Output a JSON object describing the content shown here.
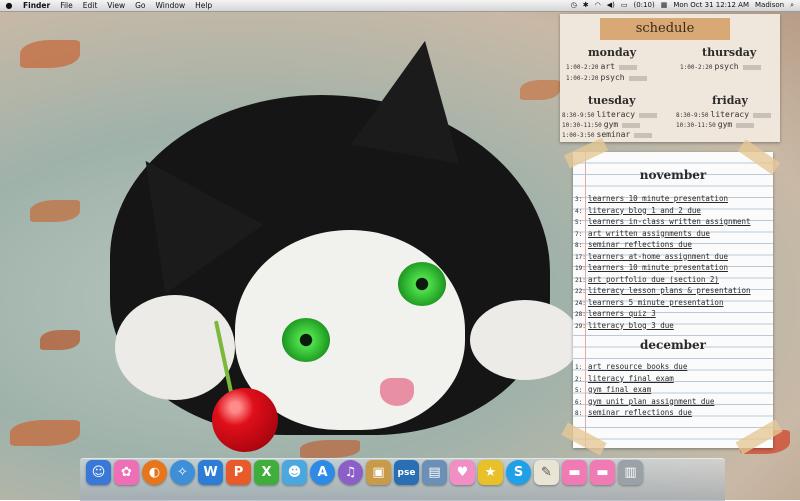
{
  "menubar": {
    "apple": "",
    "items": [
      "Finder",
      "File",
      "Edit",
      "View",
      "Go",
      "Window",
      "Help"
    ],
    "battery": "(0:10)",
    "datetime": "Mon Oct 31  12:12 AM",
    "user": "Madison"
  },
  "schedule": {
    "title": "schedule",
    "monday": {
      "label": "monday",
      "rows": [
        {
          "time": "1:00-2:20",
          "subject": "art"
        },
        {
          "time": "1:00-2:20",
          "subject": "psych"
        }
      ]
    },
    "thursday": {
      "label": "thursday",
      "rows": [
        {
          "time": "1:00-2:20",
          "subject": "psych"
        }
      ]
    },
    "tuesday": {
      "label": "tuesday",
      "rows": [
        {
          "time": "8:30-9:50",
          "subject": "literacy"
        },
        {
          "time": "10:30-11:50",
          "subject": "gym"
        },
        {
          "time": "1:00-3:50",
          "subject": "seminar"
        }
      ]
    },
    "friday": {
      "label": "friday",
      "rows": [
        {
          "time": "8:30-9:50",
          "subject": "literacy"
        },
        {
          "time": "10:30-11:50",
          "subject": "gym"
        }
      ]
    }
  },
  "paper": {
    "november": "november",
    "december": "december",
    "nov_items": [
      {
        "d": "3:",
        "t": "learners 10 minute presentation"
      },
      {
        "d": "4:",
        "t": "literacy blog 1 and 2 due"
      },
      {
        "d": "5:",
        "t": "learners in-class written assignment"
      },
      {
        "d": "7:",
        "t": "art written assignments due"
      },
      {
        "d": "8:",
        "t": "seminar            reflections due"
      },
      {
        "d": "17:",
        "t": "learners at-home assignment due"
      },
      {
        "d": "19:",
        "t": "learners 10 minute presentation"
      },
      {
        "d": "21:",
        "t": "art portfolio due (section 2)"
      },
      {
        "d": "22:",
        "t": "literacy lesson plans & presentation"
      },
      {
        "d": "24:",
        "t": "learners 5 minute presentation"
      },
      {
        "d": "28:",
        "t": "learners quiz 3"
      },
      {
        "d": "29:",
        "t": "literacy blog 3 due"
      }
    ],
    "dec_items": [
      {
        "d": "1:",
        "t": "art resource books due"
      },
      {
        "d": "2:",
        "t": "literacy final exam"
      },
      {
        "d": "5:",
        "t": "gym final exam"
      },
      {
        "d": "6:",
        "t": "gym unit plan assignment due"
      },
      {
        "d": "8:",
        "t": "seminar            reflections due"
      }
    ]
  },
  "dock": {
    "icons": [
      {
        "name": "finder-icon",
        "glyph": "☺",
        "color": "#3a78d8"
      },
      {
        "name": "flower-app-icon",
        "glyph": "✿",
        "color": "#ee6fb6"
      },
      {
        "name": "firefox-icon",
        "glyph": "◐",
        "color": "#e8751a"
      },
      {
        "name": "safari-icon",
        "glyph": "✧",
        "color": "#3f8fd8"
      },
      {
        "name": "word-icon",
        "glyph": "W",
        "color": "#2b7dd6"
      },
      {
        "name": "powerpoint-icon",
        "glyph": "P",
        "color": "#e85a2a"
      },
      {
        "name": "excel-icon",
        "glyph": "X",
        "color": "#3fae3a"
      },
      {
        "name": "messenger-icon",
        "glyph": "☻",
        "color": "#4aa7e0"
      },
      {
        "name": "app-store-icon",
        "glyph": "A",
        "color": "#2d8be6"
      },
      {
        "name": "itunes-icon",
        "glyph": "♫",
        "color": "#8b5ec8"
      },
      {
        "name": "photo-icon",
        "glyph": "▣",
        "color": "#c79b4a"
      },
      {
        "name": "photoshop-elements-icon",
        "glyph": "pse",
        "color": "#2a6fb3"
      },
      {
        "name": "preview-icon",
        "glyph": "▤",
        "color": "#6b8fb5"
      },
      {
        "name": "cupcake-icon",
        "glyph": "♥",
        "color": "#f18fc4"
      },
      {
        "name": "badge-icon",
        "glyph": "★",
        "color": "#e8c02a"
      },
      {
        "name": "skype-icon",
        "glyph": "S",
        "color": "#1fa0e8"
      },
      {
        "name": "textedit-icon",
        "glyph": "✎",
        "color": "#e9e4d4"
      },
      {
        "name": "downloads-folder-icon",
        "glyph": "▬",
        "color": "#f07ab3"
      },
      {
        "name": "documents-folder-icon",
        "glyph": "▬",
        "color": "#f07ab3"
      },
      {
        "name": "trash-icon",
        "glyph": "▥",
        "color": "#9aa2a8"
      }
    ]
  }
}
